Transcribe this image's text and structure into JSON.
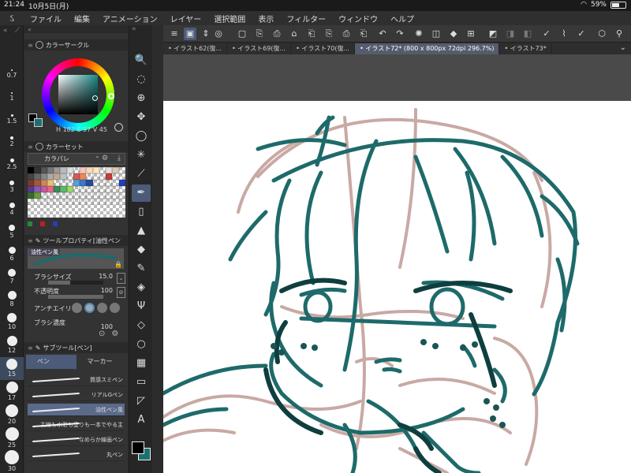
{
  "status": {
    "time": "21:24",
    "date": "10月5日(月)",
    "battery": "59%",
    "battery_level": 0.59
  },
  "menu": {
    "items": [
      "ファイル",
      "編集",
      "アニメーション",
      "レイヤー",
      "選択範囲",
      "表示",
      "フィルター",
      "ウィンドウ",
      "ヘルプ"
    ]
  },
  "brush_sizes": [
    "0.7",
    "1",
    "1.5",
    "2",
    "2.5",
    "3",
    "4",
    "5",
    "6",
    "7",
    "8",
    "10",
    "12",
    "15",
    "17",
    "20",
    "25",
    "30"
  ],
  "brush_sizes_selected": "15",
  "color_circle": {
    "title": "カラーサークル",
    "h": "182",
    "s": "97",
    "v": "45",
    "main_color": "#000000",
    "sub_color": "#1f6f70"
  },
  "color_set": {
    "title": "カラーセット",
    "set_name": "カラパレ",
    "swatches": [
      "#000000",
      "#333333",
      "#555555",
      "#777777",
      "#999999",
      "#bbbbbb",
      "#dddddd",
      "#ffffff",
      "#f4c7c3",
      "#f8d9b8",
      "#fde9c5",
      "#ffffff",
      "#e8e0d8",
      "#d8c8b8",
      "#ffffff",
      "#444444",
      "#666666",
      "#888888",
      "#aaaaaa",
      "#c2a88d",
      "#b8c0c8",
      "#ffffff",
      "#d35a5a",
      "#e88a5a",
      "#ffffff",
      "#ffffff",
      "#ffffff",
      "#c43c3c",
      "#ffffff",
      "#ffffff",
      "#7a3c2a",
      "#a35a3a",
      "#c88a5a",
      "#e6c07a",
      "#ffffff",
      "#ffffff",
      "#ffffff",
      "#5aa0d8",
      "#3c78c8",
      "#2a4a9a",
      "#ffffff",
      "#ffffff",
      "#ffffff",
      "#ffffff",
      "#2040c0",
      "#5a3a8a",
      "#8a5ab8",
      "#c85a9a",
      "#e06a8a",
      "#3c8a5a",
      "#5ab86a",
      "#9ad86a",
      "#ffffff",
      "#ffffff",
      "#ffffff",
      "#ffffff",
      "#ffffff",
      "#ffffff",
      "#ffffff",
      "#ffffff",
      "#3a6a2a",
      "#6a9a3a",
      "#ffffff",
      "#ffffff",
      "#ffffff",
      "#ffffff",
      "#ffffff",
      "#ffffff",
      "#ffffff",
      "#ffffff",
      "#ffffff",
      "#ffffff",
      "#ffffff",
      "#ffffff",
      "#ffffff",
      "#ffffff",
      "#ffffff",
      "#ffffff",
      "#ffffff",
      "#ffffff",
      "#ffffff",
      "#ffffff",
      "#ffffff",
      "#ffffff",
      "#ffffff",
      "#ffffff",
      "#ffffff",
      "#ffffff",
      "#ffffff",
      "#ffffff"
    ],
    "footer_colors": [
      "#2a8a3a",
      "#c02020",
      "#2040c0"
    ]
  },
  "tool_property": {
    "title": "ツールプロパティ[油性ペン",
    "preview_label": "油性ペン風",
    "brush_size_label": "ブラシサイズ",
    "brush_size_value": "15.0",
    "opacity_label": "不透明度",
    "opacity_value": "100",
    "antialias_label": "アンチエイリア",
    "density_label": "ブラシ濃度",
    "density_value": "100"
  },
  "subtool": {
    "title": "サブツール[ペン]",
    "tabs": [
      "ペン",
      "マーカー"
    ],
    "brushes": [
      "質感スミペン",
      "リアルGペン",
      "油性ペン風",
      "主線も水彩も塗りも一本でやる主",
      "なめらか線画ペン",
      "丸ペン"
    ],
    "selected": "油性ペン風"
  },
  "tools": [
    "🔍",
    "◌",
    "⊕",
    "✥",
    "◯",
    "✳",
    "⟋",
    "✒",
    "▯",
    "▲",
    "◆",
    "✎",
    "◈",
    "Ψ",
    "◇",
    "○",
    "▦",
    "▭",
    "◸",
    "A"
  ],
  "tools_selected": 7,
  "document_tabs": [
    "イラスト62(復...",
    "イラスト69(復...",
    "イラスト70(復...",
    "イラスト72* (800 x 800px 72dpi 296.7%)",
    "イラスト73*"
  ],
  "document_tab_selected": 3,
  "command_icons": [
    "≡",
    "▣",
    "⇕",
    "◎",
    "▢",
    "⎘",
    "⎙",
    "⌂",
    "⎗",
    "⎘",
    "⎙",
    "⎗",
    "↶",
    "↷",
    "✺",
    "◫",
    "◆",
    "⊞",
    "◩",
    "◨",
    "◧",
    "✓",
    "⌇",
    "✓",
    "⬡",
    "⚲"
  ],
  "colors": {
    "ink": "#1e6a6a",
    "sketch": "#c9a9a4",
    "accent": "#4b5b78"
  }
}
